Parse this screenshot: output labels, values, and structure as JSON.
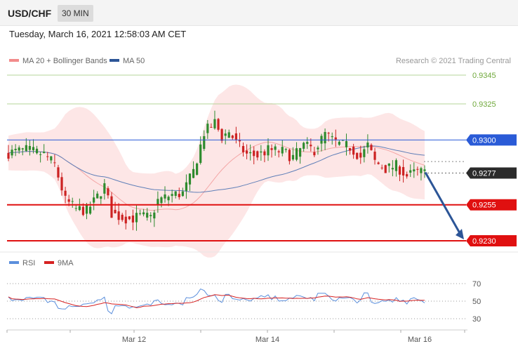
{
  "header": {
    "symbol": "USD/CHF",
    "timeframe": "30 MIN",
    "datetime": "Tuesday, March 16, 2021 12:58:03 AM CET"
  },
  "legend": {
    "ma20_label": "MA 20 + Bollinger Bands",
    "ma50_label": "MA 50",
    "ma20_color": "#f28b8b",
    "ma50_color": "#2c5597",
    "copyright": "Research © 2021 Trading Central"
  },
  "rsi_legend": {
    "rsi_label": "RSI",
    "ma_label": "9MA",
    "rsi_color": "#5b8fdc",
    "ma_color": "#d62222"
  },
  "colors": {
    "bull": "#2e8b2e",
    "bear": "#cc2222",
    "band_fill": "#fde2e2",
    "resistance": "#e01010",
    "pivot": "#2a5bd7",
    "target_green": "#6fa83a",
    "arrow": "#2c5597"
  },
  "chart_data": [
    {
      "type": "candlestick",
      "title": "USD/CHF 30 MIN",
      "ylim": [
        0.9222,
        0.9352
      ],
      "x_ticks": [
        "Mar 12",
        "Mar 14",
        "Mar 16"
      ],
      "levels": [
        {
          "value": 0.9345,
          "label": "0.9345",
          "kind": "target"
        },
        {
          "value": 0.9325,
          "label": "0.9325",
          "kind": "target"
        },
        {
          "value": 0.93,
          "label": "0.9300",
          "kind": "pivot"
        },
        {
          "value": 0.9255,
          "label": "0.9255",
          "kind": "support"
        },
        {
          "value": 0.923,
          "label": "0.9230",
          "kind": "support"
        }
      ],
      "last_price": {
        "value": 0.9277,
        "label": "0.9277"
      },
      "forecast_arrow": {
        "from": 0.9277,
        "to": 0.923
      }
    },
    {
      "type": "line",
      "title": "RSI",
      "y_ticks": [
        70,
        50,
        30
      ],
      "ylim": [
        20,
        80
      ]
    }
  ]
}
